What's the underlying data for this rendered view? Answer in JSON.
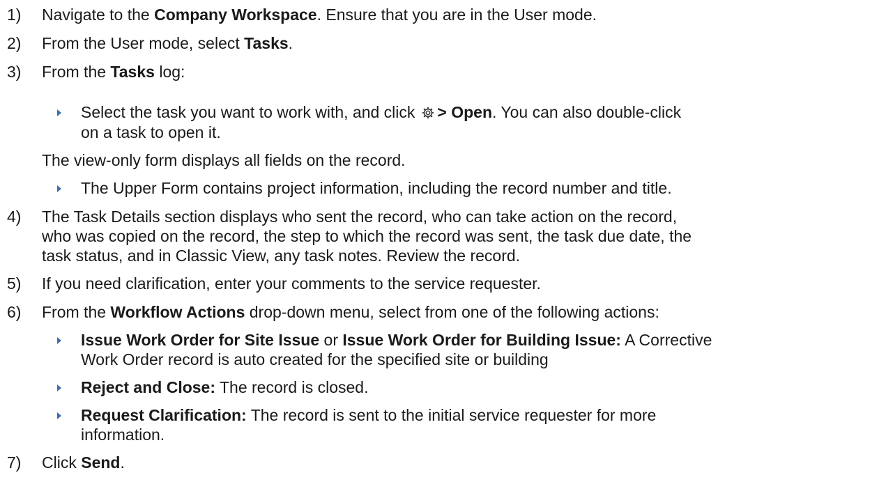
{
  "steps": [
    {
      "num": "1)",
      "lines": [
        {
          "parts": [
            {
              "t": "Navigate to the "
            },
            {
              "t": "Company Workspace",
              "b": true
            },
            {
              "t": ". Ensure that you are in the User mode."
            }
          ]
        }
      ]
    },
    {
      "num": "2)",
      "lines": [
        {
          "parts": [
            {
              "t": "From the User mode, select "
            },
            {
              "t": "Tasks",
              "b": true
            },
            {
              "t": "."
            }
          ]
        }
      ]
    },
    {
      "num": "3)",
      "lines": [
        {
          "parts": [
            {
              "t": "From the "
            },
            {
              "t": "Tasks",
              "b": true
            },
            {
              "t": " log:"
            }
          ]
        }
      ]
    }
  ],
  "step3_bullet": {
    "line1_a": "Select the task you want to work with, and click",
    "gear_icon": "gear-icon",
    "line1_b": "> Open",
    "line1_c": ". You can also double-click",
    "line2": "on a task to open it."
  },
  "view_only_note": "The view-only form displays all fields on the record.",
  "upper_form_bullet": "The Upper Form contains project information, including the record number and title.",
  "step4": {
    "num": "4)",
    "lines": [
      "The Task Details section displays who sent the record, who can take action on the record,",
      "who was copied on the record, the step to which the record was sent, the task due date, the",
      "task status, and in Classic View, any task notes. Review the record."
    ]
  },
  "step5": {
    "num": "5)",
    "text": "If you need clarification, enter your comments to the service requester."
  },
  "step6": {
    "num": "6)",
    "pre": "From the ",
    "bold": "Workflow Actions",
    "post": " drop-down menu, select from one of the following actions:"
  },
  "actions": {
    "a1_bold1": "Issue Work Order for Site Issue",
    "a1_or": " or ",
    "a1_bold2": "Issue Work Order for Building Issue:",
    "a1_rest": " A Corrective",
    "a1_line2": "Work Order record is auto created for the specified site or building",
    "a2_bold": "Reject and Close:",
    "a2_rest": " The record is closed.",
    "a3_bold": "Request Clarification:",
    "a3_rest": " The record is sent to the initial service requester for more",
    "a3_line2": "information."
  },
  "step7": {
    "num": "7)",
    "pre": "Click ",
    "bold": "Send",
    "post": "."
  },
  "colors": {
    "text": "#1a1a1a",
    "bullet": "#3d6eb0"
  }
}
